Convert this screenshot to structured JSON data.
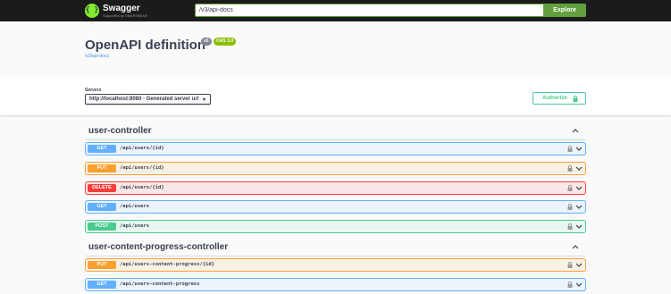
{
  "topbar": {
    "logo_title": "Swagger",
    "logo_subtitle": "Supported by SMARTBEAR",
    "url_value": "/v3/api-docs",
    "explore_label": "Explore"
  },
  "info": {
    "title": "OpenAPI definition",
    "version": "v0",
    "oas_version": "OAS 3.0",
    "doc_link": "/v3/api-docs"
  },
  "servers": {
    "label": "Servers",
    "selected": "http://localhost:8080 - Generated server url",
    "authorize_label": "Authorize"
  },
  "tags": [
    {
      "name": "user-controller",
      "operations": [
        {
          "method": "GET",
          "path": "/api/users/{id}"
        },
        {
          "method": "PUT",
          "path": "/api/users/{id}"
        },
        {
          "method": "DELETE",
          "path": "/api/users/{id}"
        },
        {
          "method": "GET",
          "path": "/api/users"
        },
        {
          "method": "POST",
          "path": "/api/users"
        }
      ]
    },
    {
      "name": "user-content-progress-controller",
      "operations": [
        {
          "method": "PUT",
          "path": "/api/users-content-progress/{id}"
        },
        {
          "method": "GET",
          "path": "/api/users-content-progress"
        }
      ]
    }
  ],
  "colors": {
    "get": "#61affe",
    "put": "#fca130",
    "delete": "#f93e3e",
    "post": "#49cc90",
    "topbar_bg": "#1b1b1b",
    "brand_green": "#85ea2d",
    "explore_green": "#62a03f"
  }
}
